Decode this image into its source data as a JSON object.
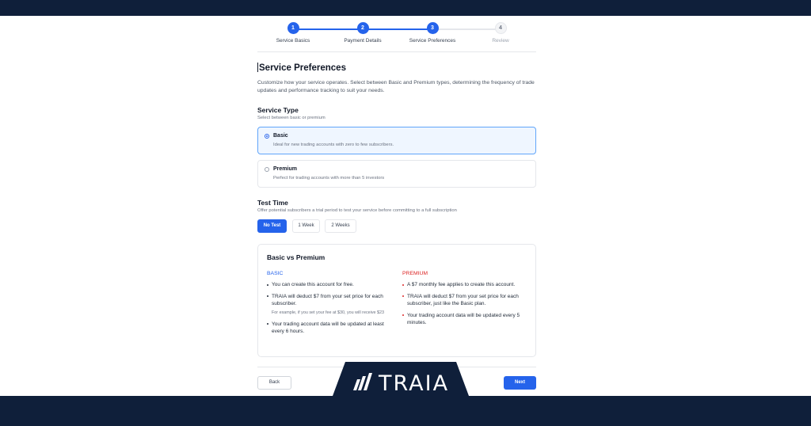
{
  "stepper": {
    "steps": [
      {
        "number": "1",
        "label": "Service Basics",
        "state": "done"
      },
      {
        "number": "2",
        "label": "Payment Details",
        "state": "done"
      },
      {
        "number": "3",
        "label": "Service Preferences",
        "state": "done"
      },
      {
        "number": "4",
        "label": "Review",
        "state": "todo"
      }
    ]
  },
  "page": {
    "title": "Service Preferences",
    "description": "Customize how your service operates. Select between Basic and Premium types, determining the frequency of trade updates and performance tracking to suit your needs."
  },
  "service_type": {
    "title": "Service Type",
    "subtitle": "Select between basic or premium",
    "options": [
      {
        "title": "Basic",
        "subtitle": "Ideal for new trading accounts with zero to few subscribers.",
        "selected": true
      },
      {
        "title": "Premium",
        "subtitle": "Perfect for trading accounts with more than 5 investors",
        "selected": false
      }
    ]
  },
  "test_time": {
    "title": "Test Time",
    "subtitle": "Offer potential subscribers a trial period to test your service before committing to a full subscription",
    "options": [
      "No Test",
      "1 Week",
      "2 Weeks"
    ],
    "selected": "No Test"
  },
  "comparison": {
    "title": "Basic vs Premium",
    "basic": {
      "heading": "BASIC",
      "bullets": [
        "You can create this account for free.",
        "TRAIA will deduct $7 from your set price for each subscriber.",
        "Your trading account data will be updated at least every 6 hours."
      ],
      "note": "For example, if you set your fee at $30, you will receive $23"
    },
    "premium": {
      "heading": "PREMIUM",
      "bullets": [
        "A $7 monthly fee applies to create this account.",
        "TRAIA will deduct $7 from your set price for each subscriber, just like the Basic plan.",
        "Your trading account data will be updated every 5 minutes."
      ]
    }
  },
  "footer": {
    "back_label": "Back",
    "next_label": "Next"
  },
  "brand": {
    "name": "TRAIA",
    "logo_icon": "traia-logo-icon",
    "navy": "#0f1f3a",
    "accent": "#2563eb",
    "premium_color": "#dc2626"
  }
}
